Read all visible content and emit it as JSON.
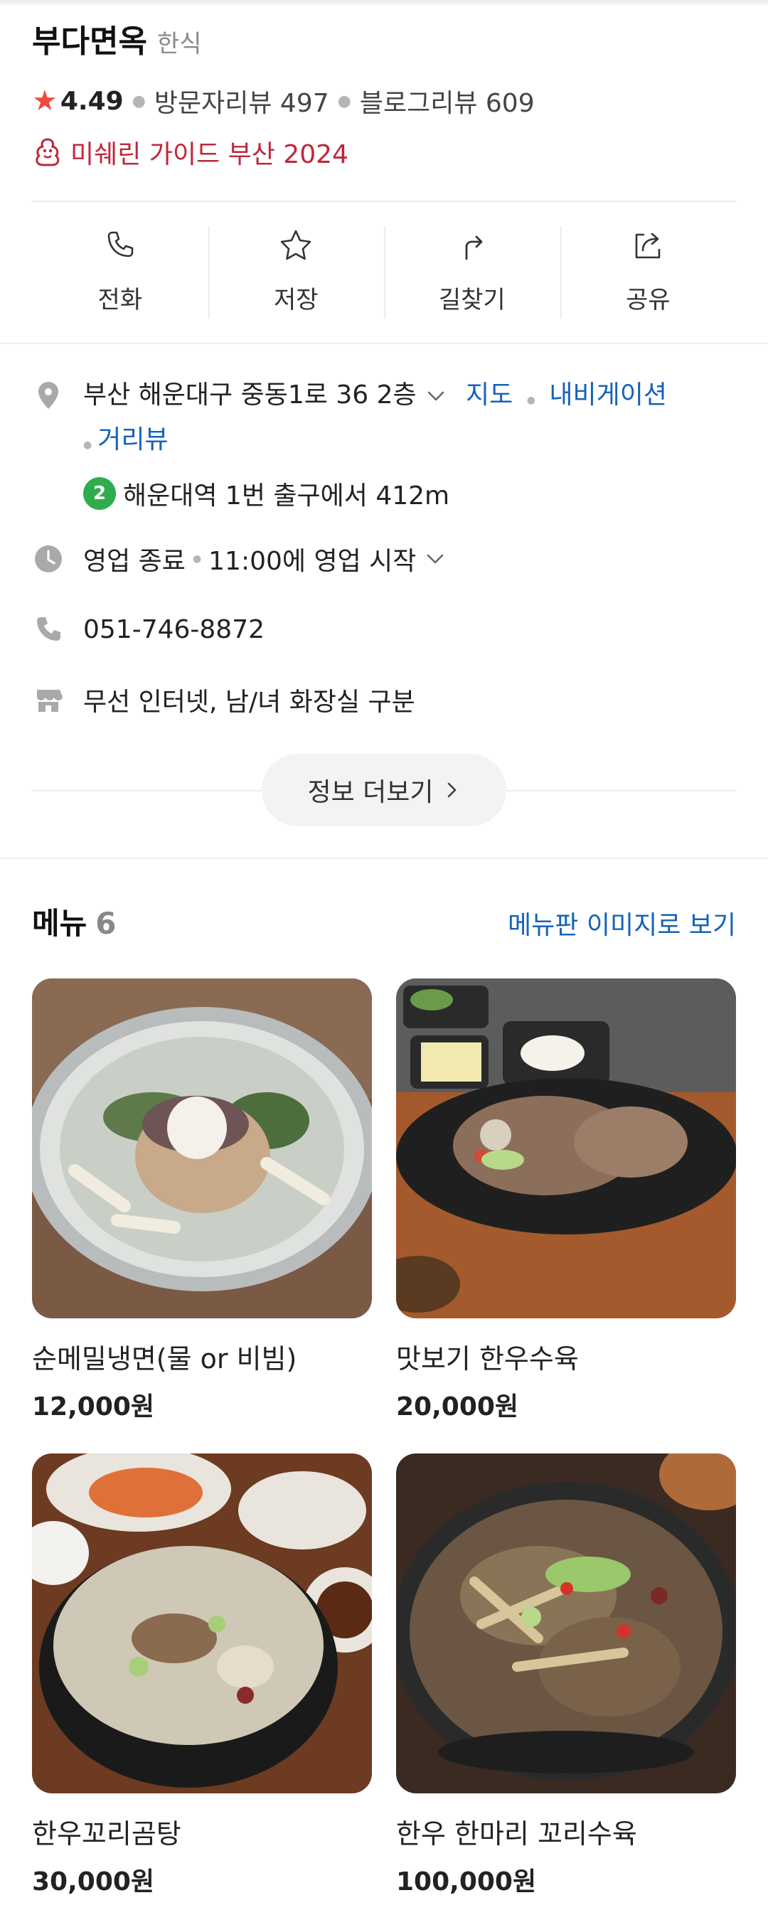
{
  "place": {
    "name": "부다면옥",
    "category": "한식",
    "rating": "4.49",
    "visitor_reviews": "방문자리뷰 497",
    "blog_reviews": "블로그리뷰 609",
    "michelin": "미쉐린 가이드 부산 2024"
  },
  "actions": [
    {
      "label": "전화",
      "icon": "phone-icon"
    },
    {
      "label": "저장",
      "icon": "star-outline-icon"
    },
    {
      "label": "길찾기",
      "icon": "directions-icon"
    },
    {
      "label": "공유",
      "icon": "share-icon"
    }
  ],
  "info": {
    "address": "부산 해운대구 중동1로 36 2층",
    "map_link": "지도",
    "navigation_link": "내비게이션",
    "street_view_link": "거리뷰",
    "subway_line": "2",
    "subway_text": "해운대역 1번 출구에서 412m",
    "hours_status": "영업 종료",
    "hours_next": "11:00에 영업 시작",
    "phone": "051-746-8872",
    "amenities": "무선 인터넷, 남/녀 화장실 구분",
    "more_button": "정보 더보기"
  },
  "menu": {
    "title": "메뉴",
    "count": "6",
    "image_link": "메뉴판 이미지로 보기",
    "items": [
      {
        "name": "순메밀냉면(물 or 비빔)",
        "price": "12,000원"
      },
      {
        "name": "맛보기 한우수육",
        "price": "20,000원"
      },
      {
        "name": "한우꼬리곰탕",
        "price": "30,000원"
      },
      {
        "name": "한우 한마리 꼬리수육",
        "price": "100,000원"
      }
    ]
  },
  "colors": {
    "accent_link": "#1663b8",
    "michelin_red": "#c0263a",
    "star_red": "#f04a40",
    "subway_line2_green": "#2fad4e"
  }
}
